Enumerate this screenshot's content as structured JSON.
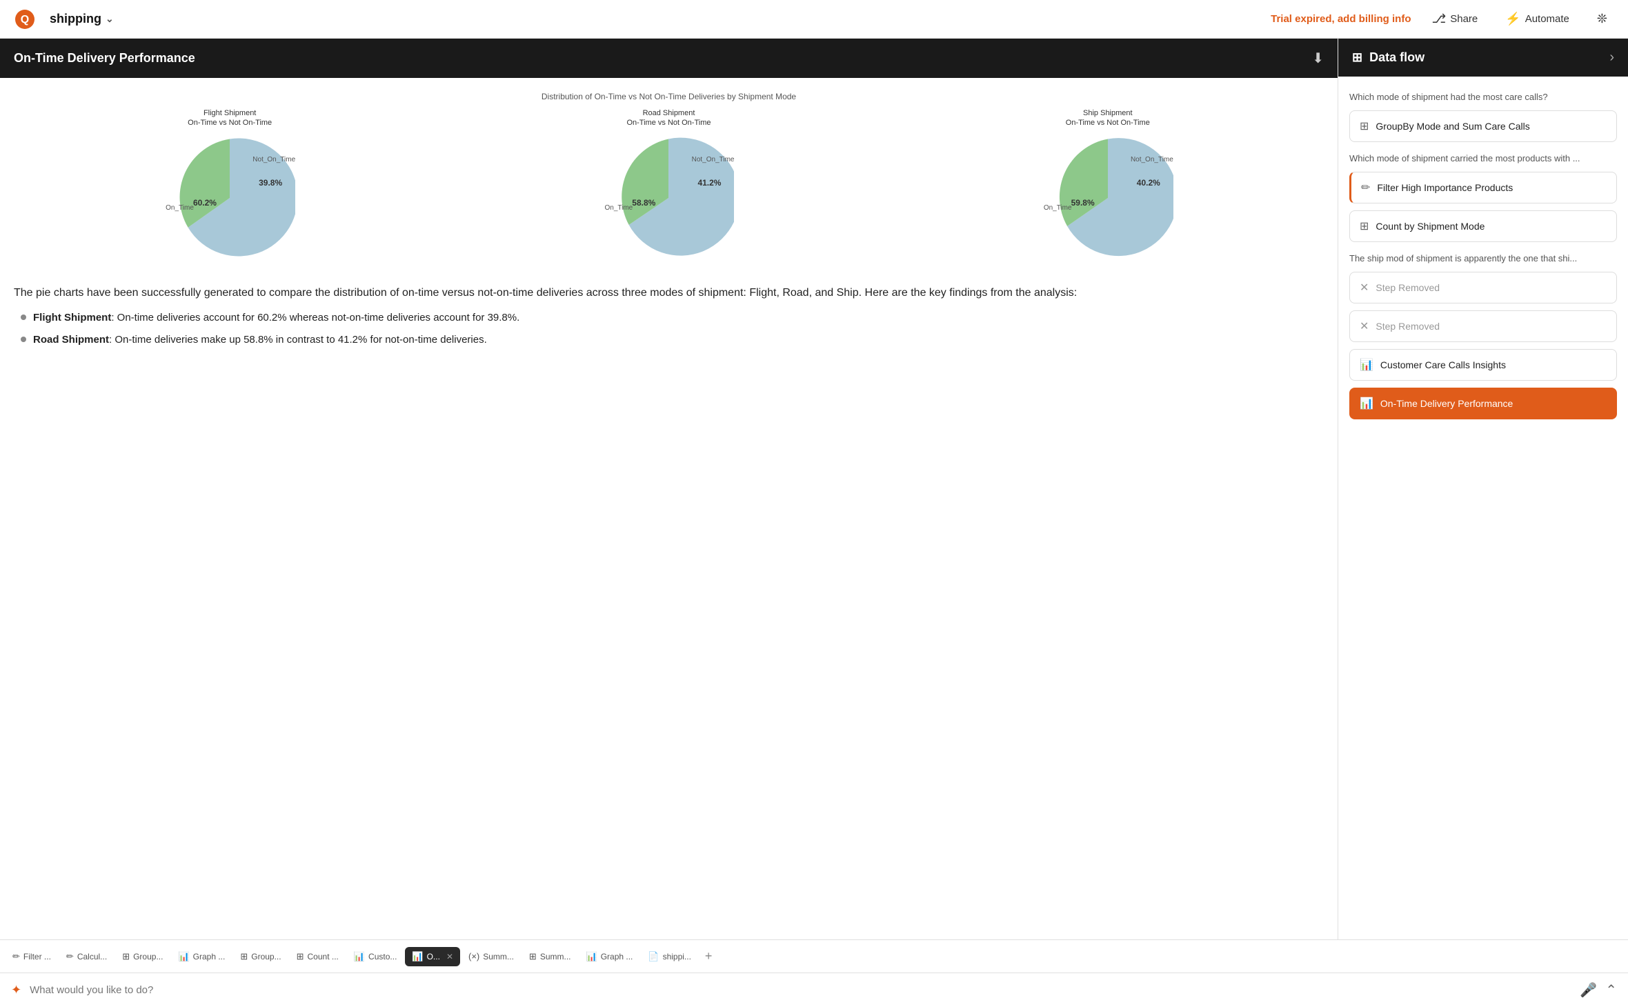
{
  "nav": {
    "title": "shipping",
    "trial_text": "Trial expired, add billing info",
    "share_label": "Share",
    "automate_label": "Automate"
  },
  "left_panel": {
    "title": "On-Time Delivery Performance",
    "chart": {
      "main_title": "Distribution of On-Time vs Not On-Time Deliveries by Shipment Mode",
      "pies": [
        {
          "title_line1": "Flight Shipment",
          "title_line2": "On-Time vs Not On-Time",
          "on_time_pct": 60.2,
          "not_on_time_pct": 39.8,
          "on_time_label": "60.2%",
          "not_on_time_label": "39.8%",
          "on_time_angle": 217,
          "label_on": "On_Time",
          "label_not": "Not_On_Time"
        },
        {
          "title_line1": "Road Shipment",
          "title_line2": "On-Time vs Not On-Time",
          "on_time_pct": 58.8,
          "not_on_time_pct": 41.2,
          "on_time_label": "58.8%",
          "not_on_time_label": "41.2%",
          "on_time_angle": 212,
          "label_on": "On_Time",
          "label_not": "Not_On_Time"
        },
        {
          "title_line1": "Ship Shipment",
          "title_line2": "On-Time vs Not On-Time",
          "on_time_pct": 59.8,
          "not_on_time_pct": 40.2,
          "on_time_label": "59.8%",
          "not_on_time_label": "40.2%",
          "on_time_angle": 215,
          "label_on": "On_Time",
          "label_not": "Not_On_Time"
        }
      ]
    },
    "description": "The pie charts have been successfully generated to compare the distribution of on-time versus not-on-time deliveries across three modes of shipment: Flight, Road, and Ship. Here are the key findings from the analysis:",
    "bullets": [
      {
        "bold": "Flight Shipment",
        "text": ": On-time deliveries account for 60.2% whereas not-on-time deliveries account for 39.8%."
      },
      {
        "bold": "Road Shipment",
        "text": ": On-time deliveries make up 58.8% in contrast to 41.2% for not-on-time deliveries."
      }
    ]
  },
  "right_panel": {
    "title": "Data flow",
    "question1": "Which mode of shipment had the most care calls?",
    "item1_label": "GroupBy Mode and Sum Care Calls",
    "question2": "Which mode of shipment carried the most products with ...",
    "item2_label": "Filter High Importance Products",
    "item3_label": "Count by Shipment Mode",
    "question3": "The ship mod of shipment is apparently the one that shi...",
    "item4_label": "Step Removed",
    "item5_label": "Step Removed",
    "item6_label": "Customer Care Calls Insights",
    "item7_label": "On-Time Delivery Performance"
  },
  "tabs": [
    {
      "icon": "✏️",
      "label": "Filter ...",
      "active": false,
      "closeable": false
    },
    {
      "icon": "✏️",
      "label": "Calcul...",
      "active": false,
      "closeable": false
    },
    {
      "icon": "⊞",
      "label": "Group...",
      "active": false,
      "closeable": false
    },
    {
      "icon": "📊",
      "label": "Graph ...",
      "active": false,
      "closeable": false
    },
    {
      "icon": "⊞",
      "label": "Group...",
      "active": false,
      "closeable": false
    },
    {
      "icon": "⊞",
      "label": "Count ...",
      "active": false,
      "closeable": false
    },
    {
      "icon": "📊",
      "label": "Custo...",
      "active": false,
      "closeable": false
    },
    {
      "icon": "📊",
      "label": "O...",
      "active": true,
      "closeable": true
    },
    {
      "icon": "(x)",
      "label": "Summ...",
      "active": false,
      "closeable": false
    },
    {
      "icon": "⊞",
      "label": "Summ...",
      "active": false,
      "closeable": false
    },
    {
      "icon": "📊",
      "label": "Graph ...",
      "active": false,
      "closeable": false
    },
    {
      "icon": "📄",
      "label": "shippi...",
      "active": false,
      "closeable": false
    }
  ],
  "input": {
    "placeholder": "What would you like to do?"
  },
  "colors": {
    "orange": "#e05c1a",
    "dark": "#1a1a1a",
    "pie_blue": "#a8c8d8",
    "pie_green": "#8dc88a"
  }
}
